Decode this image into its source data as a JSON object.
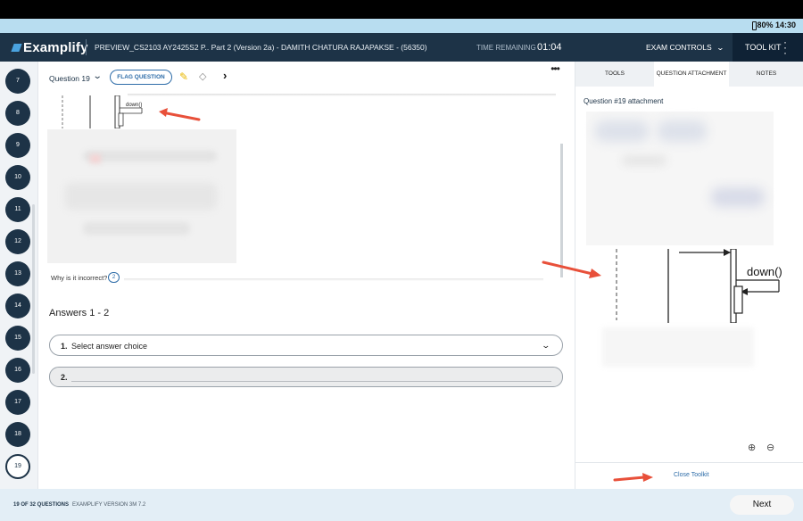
{
  "status_bar": {
    "battery": "80%",
    "time": "14:30"
  },
  "header": {
    "logo": "Examplify",
    "exam_title": "PREVIEW_CS2103 AY2425S2 P.. Part 2 (Version 2a) - DAMITH CHATURA RAJAPAKSE - (56350)",
    "time_label": "TIME REMAINING",
    "time_value": "01:04",
    "exam_controls": "EXAM CONTROLS",
    "toolkit": "TOOL KIT"
  },
  "sidebar": {
    "questions": [
      "7",
      "8",
      "9",
      "10",
      "11",
      "12",
      "13",
      "14",
      "15",
      "16",
      "17",
      "18",
      "19"
    ],
    "current": "19"
  },
  "question_bar": {
    "label": "Question 19",
    "flag_button": "FLAG QUESTION"
  },
  "question": {
    "snippet_label": "down()",
    "why_label": "Why is it incorrect?",
    "why_badge": "2",
    "answers_title": "Answers 1 - 2",
    "answers": [
      {
        "num": "1.",
        "text": "Select answer choice"
      },
      {
        "num": "2.",
        "text": ""
      }
    ]
  },
  "panel": {
    "tabs": [
      "TOOLS",
      "QUESTION ATTACHMENT",
      "NOTES"
    ],
    "active_tab": "QUESTION ATTACHMENT",
    "attachment_title": "Question #19 attachment",
    "diagram_label": "down()",
    "close_toolkit": "Close Toolkit"
  },
  "footer": {
    "count": "19 OF 32 QUESTIONS",
    "version": "EXAMPLIFY VERSION 3M 7.2",
    "next": "Next"
  },
  "colors": {
    "header": "#1d3347",
    "accent": "#2d6ca8",
    "status_bar": "#b8ddf0",
    "arrow": "#e8503a"
  }
}
